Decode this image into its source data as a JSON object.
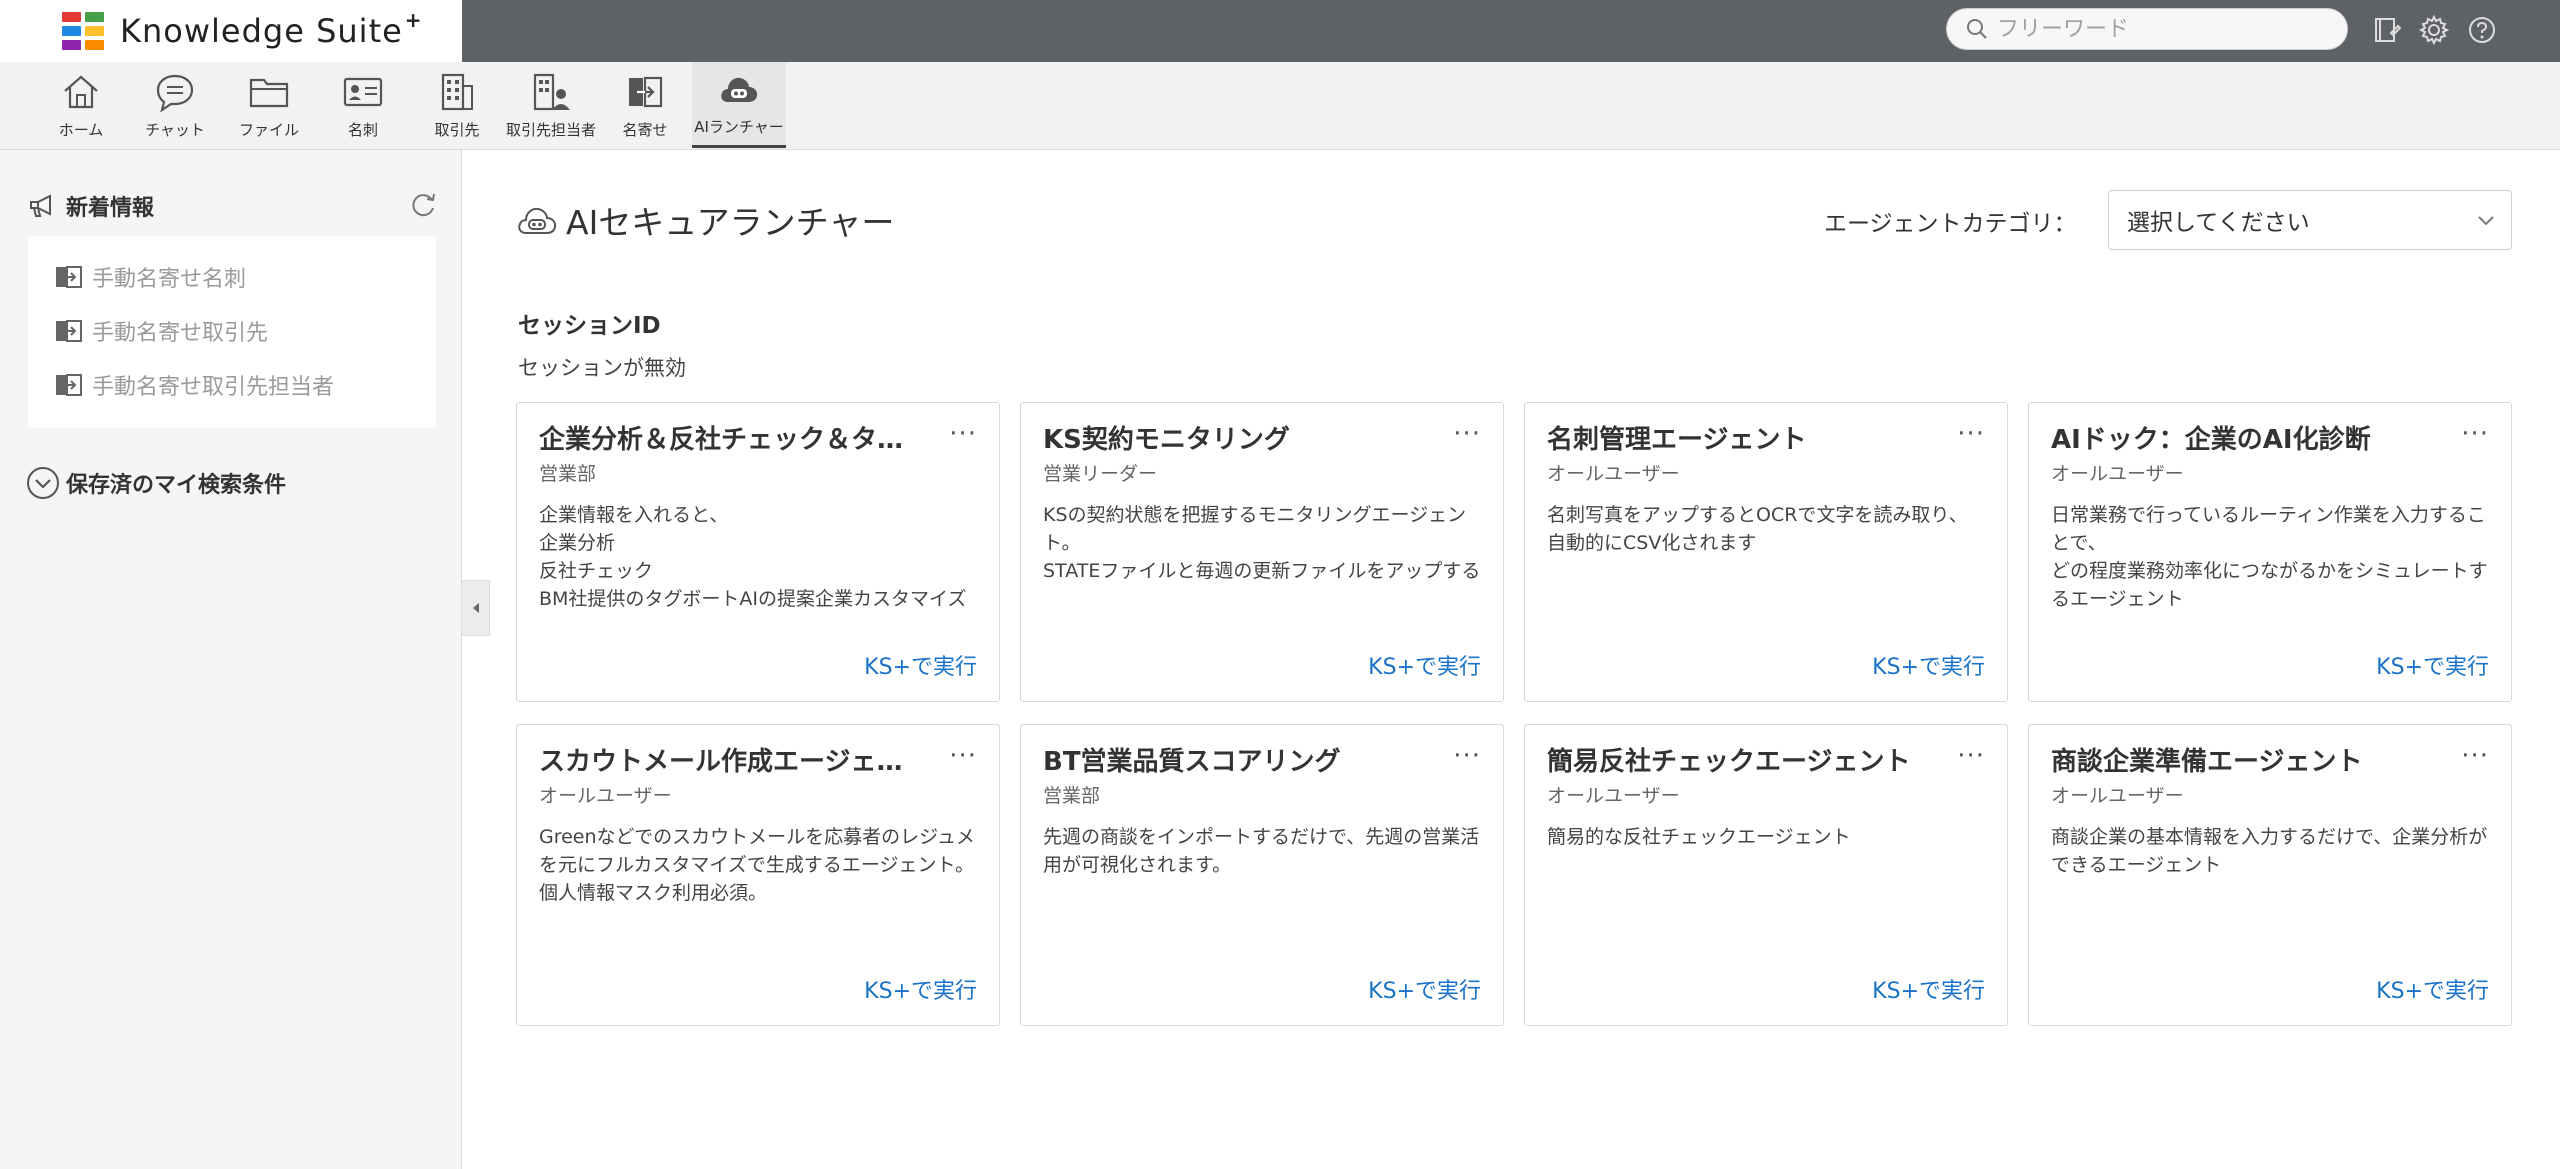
{
  "app": {
    "name": "Knowledge Suite",
    "name_mark": "+",
    "logo_colors": [
      "#e53935",
      "#43a047",
      "#1e88e5",
      "#fbc02d",
      "#8e24aa",
      "#fb8c00"
    ]
  },
  "search": {
    "placeholder": "フリーワード"
  },
  "top_icons": [
    "notebook-icon",
    "gear-icon",
    "help-icon"
  ],
  "nav": {
    "items": [
      {
        "label": "ホーム",
        "icon": "home-icon"
      },
      {
        "label": "チャット",
        "icon": "chat-icon"
      },
      {
        "label": "ファイル",
        "icon": "folder-icon"
      },
      {
        "label": "名刺",
        "icon": "business-card-icon"
      },
      {
        "label": "取引先",
        "icon": "building-icon"
      },
      {
        "label": "取引先担当者",
        "icon": "building-person-icon"
      },
      {
        "label": "名寄せ",
        "icon": "merge-icon"
      },
      {
        "label": "AIランチャー",
        "icon": "ai-cloud-icon"
      }
    ],
    "active_index": 7
  },
  "sidebar": {
    "news_title": "新着情報",
    "links": [
      "手動名寄せ名刺",
      "手動名寄せ取引先",
      "手動名寄せ取引先担当者"
    ],
    "saved_title": "保存済のマイ検索条件"
  },
  "main": {
    "title": "AIセキュアランチャー",
    "category_label": "エージェントカテゴリ：",
    "category_value": "選択してください",
    "session_label": "セッションID",
    "session_status": "セッションが無効",
    "run_label": "KS+で実行",
    "more_label": "···",
    "cards": [
      {
        "title": "企業分析＆反社チェック＆タグボートAIの提案企業カスタマイズ",
        "dept": "営業部",
        "desc": "企業情報を入れると、\n企業分析\n反社チェック\nBM社提供のタグボートAIの提案企業カスタマイズ"
      },
      {
        "title": "KS契約モニタリング",
        "dept": "営業リーダー",
        "desc": "KSの契約状態を把握するモニタリングエージェント。\nSTATEファイルと毎週の更新ファイルをアップする"
      },
      {
        "title": "名刺管理エージェント",
        "dept": "オールユーザー",
        "desc": "名刺写真をアップするとOCRで文字を読み取り、\n自動的にCSV化されます"
      },
      {
        "title": "AIドック：企業のAI化診断",
        "dept": "オールユーザー",
        "desc": "日常業務で行っているルーティン作業を入力することで、\nどの程度業務効率化につながるかをシミュレートするエージェント"
      },
      {
        "title": "スカウトメール作成エージェント",
        "dept": "オールユーザー",
        "desc": "Greenなどでのスカウトメールを応募者のレジュメを元にフルカスタマイズで生成するエージェント。個人情報マスク利用必須。"
      },
      {
        "title": "BT営業品質スコアリング",
        "dept": "営業部",
        "desc": "先週の商談をインポートするだけで、先週の営業活用が可視化されます。"
      },
      {
        "title": "簡易反社チェックエージェント",
        "dept": "オールユーザー",
        "desc": "簡易的な反社チェックエージェント"
      },
      {
        "title": "商談企業準備エージェント",
        "dept": "オールユーザー",
        "desc": "商談企業の基本情報を入力するだけで、企業分析ができるエージェント"
      }
    ]
  }
}
